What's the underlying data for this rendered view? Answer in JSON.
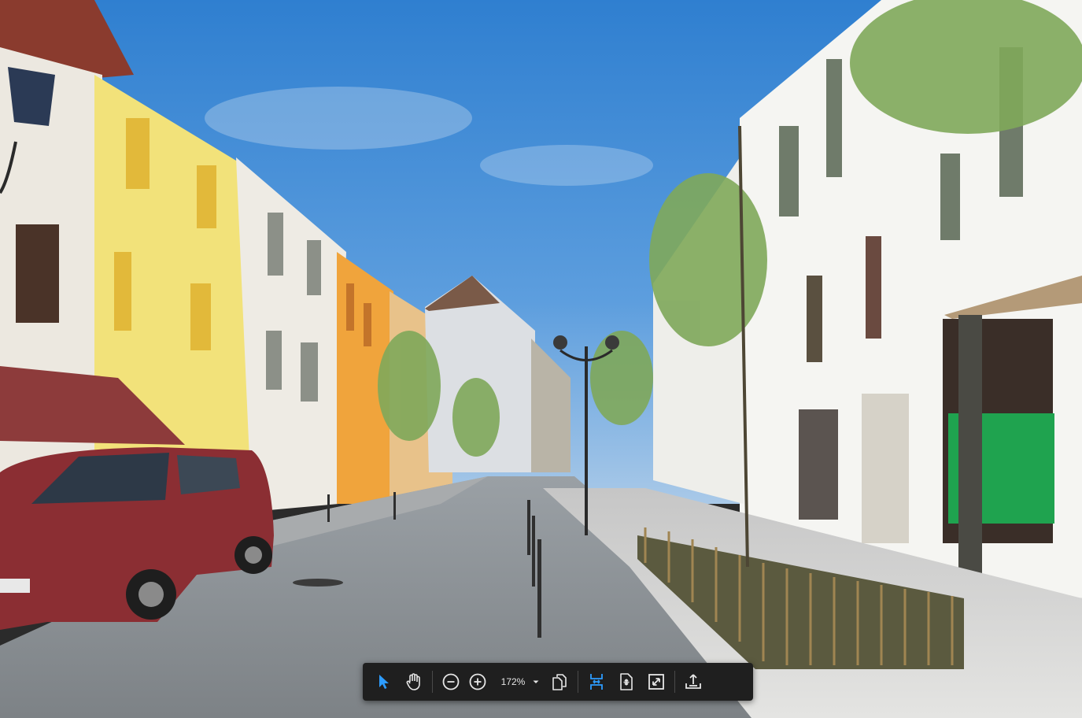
{
  "viewer": {
    "image_description_alt": "",
    "photo_icon": "street-photo"
  },
  "toolbar": {
    "zoom_value": "172%",
    "accent_color": "#2d9cff",
    "icon_color": "#e6e6e6",
    "tools": [
      {
        "name": "select-tool",
        "icon": "cursor-icon",
        "active": true
      },
      {
        "name": "pan-tool",
        "icon": "hand-icon",
        "active": false
      },
      {
        "name": "zoom-out",
        "icon": "minus-circle-icon",
        "active": false
      },
      {
        "name": "zoom-in",
        "icon": "plus-circle-icon",
        "active": false
      },
      {
        "name": "zoom-dropdown",
        "icon": "chevron-down-icon",
        "active": false
      },
      {
        "name": "page-view",
        "icon": "copy-pages-icon",
        "active": false
      },
      {
        "name": "fit-width",
        "icon": "fit-width-icon",
        "active": true
      },
      {
        "name": "fit-page",
        "icon": "fit-page-icon",
        "active": false
      },
      {
        "name": "fullscreen",
        "icon": "expand-icon",
        "active": false
      },
      {
        "name": "export",
        "icon": "upload-icon",
        "active": false
      }
    ]
  }
}
